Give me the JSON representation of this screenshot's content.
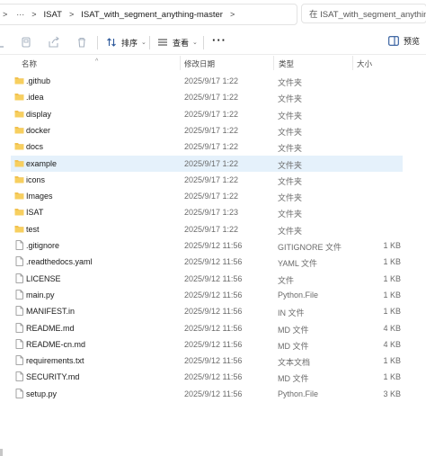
{
  "address_bar": {
    "crumbs": [
      "ISAT",
      "ISAT_with_segment_anything-master"
    ],
    "search_placeholder": "在 ISAT_with_segment_anything-master 中搜索"
  },
  "toolbar": {
    "sort_label": "排序",
    "view_label": "查看",
    "preview_label": "预览"
  },
  "columns": {
    "name": "名称",
    "date": "修改日期",
    "type": "类型",
    "size": "大小"
  },
  "files": [
    {
      "name": ".github",
      "date": "2025/9/17 1:22",
      "type": "文件夹",
      "size": "",
      "kind": "folder"
    },
    {
      "name": ".idea",
      "date": "2025/9/17 1:22",
      "type": "文件夹",
      "size": "",
      "kind": "folder"
    },
    {
      "name": "display",
      "date": "2025/9/17 1:22",
      "type": "文件夹",
      "size": "",
      "kind": "folder"
    },
    {
      "name": "docker",
      "date": "2025/9/17 1:22",
      "type": "文件夹",
      "size": "",
      "kind": "folder"
    },
    {
      "name": "docs",
      "date": "2025/9/17 1:22",
      "type": "文件夹",
      "size": "",
      "kind": "folder"
    },
    {
      "name": "example",
      "date": "2025/9/17 1:22",
      "type": "文件夹",
      "size": "",
      "kind": "folder",
      "selected": true
    },
    {
      "name": "icons",
      "date": "2025/9/17 1:22",
      "type": "文件夹",
      "size": "",
      "kind": "folder"
    },
    {
      "name": "Images",
      "date": "2025/9/17 1:22",
      "type": "文件夹",
      "size": "",
      "kind": "folder"
    },
    {
      "name": "ISAT",
      "date": "2025/9/17 1:23",
      "type": "文件夹",
      "size": "",
      "kind": "folder"
    },
    {
      "name": "test",
      "date": "2025/9/17 1:22",
      "type": "文件夹",
      "size": "",
      "kind": "folder"
    },
    {
      "name": ".gitignore",
      "date": "2025/9/12 11:56",
      "type": "GITIGNORE 文件",
      "size": "1 KB",
      "kind": "file"
    },
    {
      "name": ".readthedocs.yaml",
      "date": "2025/9/12 11:56",
      "type": "YAML 文件",
      "size": "1 KB",
      "kind": "file"
    },
    {
      "name": "LICENSE",
      "date": "2025/9/12 11:56",
      "type": "文件",
      "size": "1 KB",
      "kind": "file"
    },
    {
      "name": "main.py",
      "date": "2025/9/12 11:56",
      "type": "Python.File",
      "size": "1 KB",
      "kind": "file"
    },
    {
      "name": "MANIFEST.in",
      "date": "2025/9/12 11:56",
      "type": "IN 文件",
      "size": "1 KB",
      "kind": "file"
    },
    {
      "name": "README.md",
      "date": "2025/9/12 11:56",
      "type": "MD 文件",
      "size": "4 KB",
      "kind": "file"
    },
    {
      "name": "README-cn.md",
      "date": "2025/9/12 11:56",
      "type": "MD 文件",
      "size": "4 KB",
      "kind": "file"
    },
    {
      "name": "requirements.txt",
      "date": "2025/9/12 11:56",
      "type": "文本文档",
      "size": "1 KB",
      "kind": "file"
    },
    {
      "name": "SECURITY.md",
      "date": "2025/9/12 11:56",
      "type": "MD 文件",
      "size": "1 KB",
      "kind": "file"
    },
    {
      "name": "setup.py",
      "date": "2025/9/12 11:56",
      "type": "Python.File",
      "size": "3 KB",
      "kind": "file"
    }
  ],
  "colors": {
    "folder": "#f2c14e",
    "selection": "#e5f1fb",
    "accent": "#0067c0"
  }
}
